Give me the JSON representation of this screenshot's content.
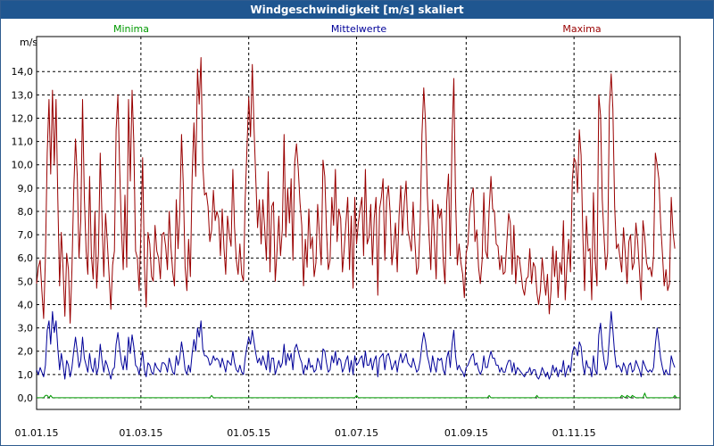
{
  "window": {
    "title": "Windgeschwindigkeit [m/s] skaliert"
  },
  "chart_data": {
    "type": "line",
    "title": "Windgeschwindigkeit [m/s] skaliert",
    "ylabel": "m/s",
    "xlabel": "",
    "grid": true,
    "x_range": [
      "01.01.15",
      "31.12.15"
    ],
    "ylim": [
      -0.5,
      15.5
    ],
    "y_ticks": [
      "0,0",
      "1,0",
      "2,0",
      "3,0",
      "4,0",
      "5,0",
      "6,0",
      "7,0",
      "8,0",
      "9,0",
      "10,0",
      "11,0",
      "12,0",
      "13,0",
      "14,0"
    ],
    "x_ticks": [
      "01.01.15",
      "01.03.15",
      "01.05.15",
      "01.07.15",
      "01.09.15",
      "01.11.15"
    ],
    "legend": [
      {
        "name": "Minima",
        "color": "#009900"
      },
      {
        "name": "Mittelwerte",
        "color": "#000099"
      },
      {
        "name": "Maxima",
        "color": "#990000"
      }
    ],
    "series": [
      {
        "name": "Maxima",
        "color": "#990000",
        "day_step": 1,
        "values": [
          4.9,
          5.6,
          5.9,
          4.6,
          3.4,
          6.0,
          10.5,
          12.8,
          9.6,
          13.2,
          10.0,
          12.8,
          8.5,
          4.8,
          7.1,
          5.5,
          3.5,
          6.2,
          5.5,
          3.2,
          5.5,
          8.9,
          11.1,
          9.5,
          6.0,
          7.6,
          12.8,
          8.6,
          6.3,
          5.3,
          9.5,
          6.1,
          5.1,
          8.0,
          4.7,
          6.2,
          10.5,
          7.7,
          5.2,
          7.9,
          6.7,
          5.3,
          3.8,
          5.7,
          6.3,
          11.5,
          13.0,
          9.8,
          7.2,
          5.5,
          8.7,
          5.6,
          12.8,
          9.3,
          13.2,
          11.0,
          6.3,
          6.0,
          4.6,
          7.2,
          10.3,
          5.7,
          3.9,
          7.1,
          6.6,
          5.2,
          5.0,
          7.4,
          6.3,
          6.0,
          5.1,
          7.0,
          7.1,
          6.5,
          5.5,
          8.0,
          6.5,
          5.4,
          4.8,
          8.5,
          6.4,
          7.9,
          11.3,
          9.1,
          5.6,
          4.6,
          6.8,
          5.2,
          9.5,
          11.8,
          9.5,
          14.1,
          12.6,
          14.6,
          10.0,
          8.7,
          8.8,
          8.2,
          6.7,
          7.2,
          8.9,
          7.6,
          8.0,
          7.7,
          6.1,
          8.1,
          6.4,
          5.3,
          7.8,
          7.0,
          6.5,
          9.8,
          7.3,
          5.9,
          5.3,
          6.6,
          5.3,
          5.0,
          8.5,
          10.7,
          12.9,
          11.2,
          14.3,
          11.6,
          9.4,
          7.3,
          8.5,
          6.6,
          8.5,
          7.3,
          5.9,
          9.7,
          5.4,
          8.2,
          8.4,
          5.0,
          6.3,
          7.8,
          6.1,
          7.2,
          11.3,
          6.9,
          9.0,
          7.5,
          9.4,
          5.9,
          10.1,
          10.9,
          9.8,
          8.4,
          7.4,
          4.8,
          6.8,
          5.6,
          8.1,
          6.4,
          6.9,
          5.2,
          5.8,
          8.3,
          7.0,
          5.7,
          10.2,
          9.5,
          7.2,
          5.5,
          5.9,
          8.6,
          7.4,
          9.8,
          6.7,
          8.1,
          7.7,
          5.4,
          6.4,
          7.5,
          8.6,
          5.5,
          7.8,
          4.7,
          8.6,
          6.6,
          7.5,
          8.1,
          8.6,
          6.1,
          9.8,
          6.6,
          6.9,
          8.3,
          5.7,
          7.7,
          8.6,
          4.4,
          8.1,
          8.6,
          9.4,
          5.9,
          8.5,
          9.1,
          7.9,
          5.7,
          6.5,
          7.5,
          5.4,
          7.8,
          9.1,
          7.0,
          8.4,
          9.3,
          7.2,
          6.8,
          6.3,
          8.4,
          6.7,
          5.3,
          5.6,
          7.5,
          11.3,
          13.3,
          11.8,
          8.7,
          7.0,
          5.5,
          8.5,
          6.8,
          5.1,
          8.3,
          7.7,
          8.1,
          5.9,
          4.9,
          8.4,
          9.6,
          6.1,
          11.2,
          13.7,
          8.6,
          5.7,
          6.6,
          5.8,
          5.3,
          4.3,
          6.2,
          6.6,
          8.0,
          8.7,
          9.0,
          6.7,
          7.2,
          5.6,
          4.9,
          5.9,
          8.8,
          6.3,
          6.0,
          8.1,
          9.5,
          8.1,
          8.0,
          6.6,
          6.5,
          5.5,
          6.1,
          5.3,
          5.4,
          6.7,
          7.9,
          7.5,
          5.3,
          7.4,
          4.9,
          6.1,
          6.0,
          5.4,
          4.7,
          4.4,
          5.1,
          5.2,
          6.4,
          4.9,
          5.8,
          5.6,
          4.5,
          4.0,
          4.6,
          6.0,
          5.1,
          4.4,
          5.3,
          3.6,
          4.6,
          6.5,
          5.2,
          6.3,
          4.3,
          5.8,
          5.3,
          7.6,
          4.2,
          5.7,
          6.8,
          5.4,
          9.3,
          10.3,
          10.1,
          8.8,
          11.5,
          10.4,
          6.9,
          4.6,
          7.8,
          6.3,
          6.4,
          4.2,
          8.8,
          5.9,
          4.8,
          13.0,
          12.1,
          8.5,
          6.9,
          5.5,
          6.2,
          12.5,
          13.9,
          12.4,
          8.2,
          6.4,
          6.6,
          6.0,
          5.4,
          7.3,
          6.2,
          4.9,
          6.7,
          7.0,
          5.5,
          5.8,
          7.5,
          6.7,
          5.5,
          4.2,
          7.6,
          6.9,
          5.8,
          5.5,
          5.6,
          5.2,
          6.1,
          10.5,
          10.0,
          9.4,
          7.5,
          6.2,
          4.8,
          5.5,
          4.6,
          4.9,
          8.6,
          7.1,
          6.4
        ]
      },
      {
        "name": "Mittelwerte",
        "color": "#000099",
        "day_step": 1,
        "values": [
          1.2,
          1.0,
          1.3,
          1.1,
          0.9,
          1.4,
          2.9,
          3.3,
          2.3,
          3.7,
          2.8,
          3.3,
          2.1,
          1.2,
          1.9,
          1.4,
          0.8,
          1.6,
          1.4,
          0.9,
          1.3,
          2.0,
          2.6,
          2.0,
          1.3,
          1.6,
          2.6,
          1.7,
          1.4,
          1.1,
          1.9,
          1.3,
          1.1,
          1.7,
          1.0,
          1.3,
          2.3,
          1.6,
          1.1,
          1.6,
          1.4,
          1.1,
          0.8,
          1.2,
          1.3,
          2.3,
          2.8,
          2.1,
          1.5,
          1.2,
          1.8,
          1.2,
          2.6,
          1.9,
          2.7,
          2.2,
          1.4,
          1.3,
          1.0,
          1.5,
          2.0,
          1.2,
          0.9,
          1.5,
          1.4,
          1.1,
          1.0,
          1.5,
          1.3,
          1.2,
          1.1,
          1.5,
          1.5,
          1.4,
          1.1,
          1.7,
          1.4,
          1.1,
          1.0,
          1.8,
          1.4,
          1.7,
          2.4,
          1.9,
          1.2,
          1.0,
          1.4,
          1.1,
          1.9,
          2.5,
          2.0,
          3.0,
          2.6,
          3.3,
          2.1,
          1.8,
          1.8,
          1.7,
          1.4,
          1.5,
          1.8,
          1.6,
          1.7,
          1.6,
          1.3,
          1.7,
          1.4,
          1.1,
          1.6,
          1.5,
          1.4,
          2.0,
          1.5,
          1.2,
          1.1,
          1.4,
          1.1,
          1.0,
          1.7,
          2.2,
          2.6,
          2.3,
          2.9,
          2.4,
          1.9,
          1.5,
          1.7,
          1.4,
          1.8,
          1.5,
          1.2,
          2.0,
          1.1,
          1.7,
          1.7,
          1.0,
          1.3,
          1.6,
          1.3,
          1.5,
          2.3,
          1.4,
          1.9,
          1.6,
          1.9,
          1.2,
          2.1,
          2.3,
          2.0,
          1.7,
          1.5,
          1.0,
          1.4,
          1.2,
          1.7,
          1.3,
          1.4,
          1.1,
          1.2,
          1.7,
          1.5,
          1.2,
          2.1,
          2.0,
          1.5,
          1.1,
          1.2,
          1.8,
          1.5,
          2.0,
          1.4,
          1.7,
          1.6,
          1.1,
          1.3,
          1.6,
          1.8,
          1.1,
          1.6,
          1.0,
          1.8,
          1.4,
          1.5,
          1.7,
          1.8,
          1.3,
          2.0,
          1.4,
          1.4,
          1.7,
          1.2,
          1.6,
          1.8,
          0.9,
          1.7,
          1.8,
          1.9,
          1.2,
          1.8,
          1.9,
          1.6,
          1.2,
          1.4,
          1.6,
          1.1,
          1.6,
          1.9,
          1.5,
          1.7,
          1.9,
          1.5,
          1.4,
          1.3,
          1.7,
          1.4,
          1.1,
          1.2,
          1.6,
          2.3,
          2.8,
          2.4,
          1.8,
          1.5,
          1.1,
          1.8,
          1.4,
          1.1,
          1.7,
          1.6,
          1.7,
          1.2,
          1.0,
          1.7,
          2.0,
          1.3,
          2.3,
          2.9,
          1.8,
          1.2,
          1.4,
          1.2,
          1.1,
          0.9,
          1.3,
          1.4,
          1.6,
          1.8,
          1.9,
          1.4,
          1.5,
          1.2,
          1.0,
          1.2,
          1.8,
          1.3,
          1.3,
          1.7,
          2.0,
          1.7,
          1.7,
          1.4,
          1.4,
          1.1,
          1.3,
          1.1,
          1.1,
          1.4,
          1.6,
          1.6,
          1.1,
          1.5,
          1.0,
          1.3,
          1.2,
          1.1,
          1.0,
          0.9,
          1.1,
          1.1,
          1.3,
          1.0,
          1.2,
          1.2,
          0.9,
          0.8,
          1.0,
          1.3,
          1.1,
          0.9,
          1.1,
          0.8,
          1.0,
          1.4,
          1.1,
          1.3,
          0.9,
          1.2,
          1.1,
          1.6,
          0.9,
          1.2,
          1.4,
          1.1,
          1.9,
          2.2,
          2.1,
          1.8,
          2.4,
          2.2,
          1.4,
          1.0,
          1.6,
          1.3,
          1.3,
          0.9,
          1.8,
          1.2,
          1.0,
          2.7,
          3.2,
          2.2,
          1.6,
          1.2,
          1.5,
          2.6,
          3.7,
          2.9,
          1.9,
          1.3,
          1.4,
          1.3,
          1.1,
          1.5,
          1.3,
          1.0,
          1.4,
          1.5,
          1.1,
          1.2,
          1.6,
          1.4,
          1.2,
          0.9,
          1.6,
          1.4,
          1.2,
          1.1,
          1.2,
          1.1,
          1.3,
          2.3,
          3.0,
          2.4,
          1.7,
          1.3,
          1.0,
          1.2,
          1.0,
          1.0,
          1.8,
          1.5,
          1.3
        ]
      },
      {
        "name": "Minima",
        "color": "#009900",
        "points": [
          [
            0,
            0.0
          ],
          [
            4,
            0.0
          ],
          [
            5,
            0.1
          ],
          [
            6,
            0.1
          ],
          [
            7,
            0.0
          ],
          [
            8,
            0.1
          ],
          [
            9,
            0.0
          ],
          [
            98,
            0.0
          ],
          [
            99,
            0.1
          ],
          [
            100,
            0.0
          ],
          [
            180,
            0.0
          ],
          [
            181,
            0.1
          ],
          [
            182,
            0.0
          ],
          [
            255,
            0.0
          ],
          [
            256,
            0.1
          ],
          [
            257,
            0.0
          ],
          [
            282,
            0.0
          ],
          [
            283,
            0.1
          ],
          [
            284,
            0.0
          ],
          [
            330,
            0.0
          ],
          [
            331,
            0.1
          ],
          [
            333,
            0.0
          ],
          [
            334,
            0.1
          ],
          [
            336,
            0.0
          ],
          [
            337,
            0.1
          ],
          [
            339,
            0.0
          ],
          [
            343,
            0.0
          ],
          [
            344,
            0.2
          ],
          [
            345,
            0.0
          ],
          [
            360,
            0.0
          ],
          [
            361,
            0.1
          ],
          [
            362,
            0.0
          ],
          [
            364,
            0.0
          ]
        ]
      }
    ]
  }
}
